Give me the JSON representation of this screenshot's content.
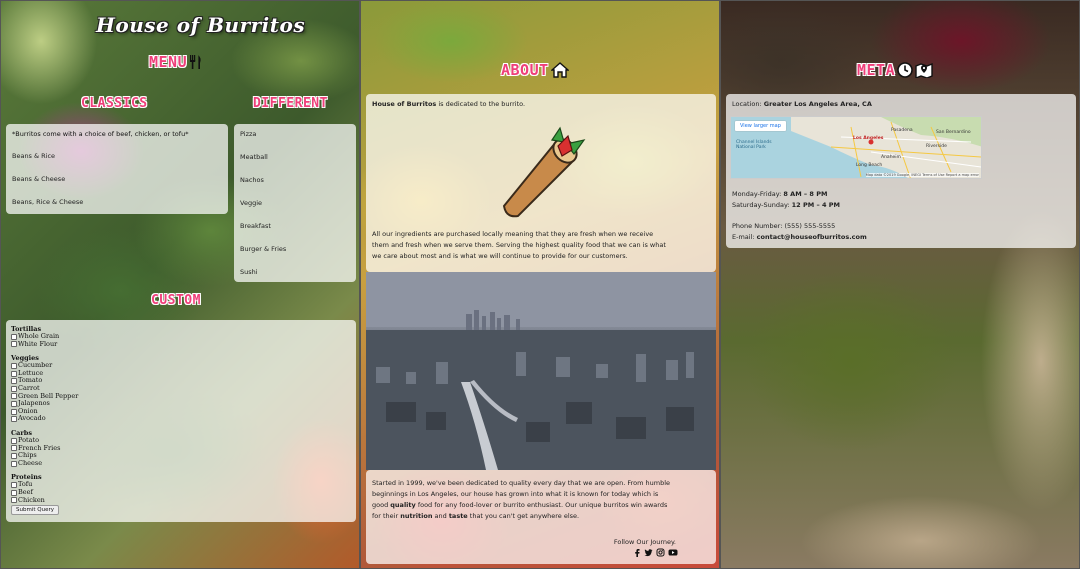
{
  "site": {
    "title": "House of Burritos"
  },
  "menu": {
    "heading": "MENU",
    "classics": {
      "heading": "CLASSICS",
      "note": "*Burritos come with a choice of beef, chicken, or tofu*",
      "items": [
        "Beans & Rice",
        "Beans & Cheese",
        "Beans, Rice & Cheese"
      ]
    },
    "different": {
      "heading": "DIFFERENT",
      "items": [
        "Pizza",
        "Meatball",
        "Nachos",
        "Veggie",
        "Breakfast",
        "Burger & Fries",
        "Sushi"
      ]
    },
    "custom": {
      "heading": "CUSTOM",
      "groups": [
        {
          "title": "Tortillas",
          "options": [
            "Whole Grain",
            "White Flour"
          ]
        },
        {
          "title": "Veggies",
          "options": [
            "Cucumber",
            "Lettuce",
            "Tomato",
            "Carrot",
            "Green Bell Pepper",
            "Jalapenos",
            "Onion",
            "Avocado"
          ]
        },
        {
          "title": "Carbs",
          "options": [
            "Potato",
            "French Fries",
            "Chips",
            "Cheese"
          ]
        },
        {
          "title": "Proteins",
          "options": [
            "Tofu",
            "Beef",
            "Chicken"
          ]
        }
      ],
      "submit_label": "Submit Query"
    }
  },
  "about": {
    "heading": "ABOUT",
    "intro_bold": "House of Burritos",
    "intro_rest": " is dedicated to the burrito.",
    "paragraph": "All our ingredients are purchased locally meaning that they are fresh when we receive them and fresh when we serve them. Serving the highest quality food that we can is what we care about most and is what we will continue to provide for our customers.",
    "story_part1": "Started in 1999, we've been dedicated to quality every day that we are open. From humble beginnings in Los Angeles, our house has grown into what it is known for today which is good ",
    "story_bold1": "quality",
    "story_part2": " food for any food-lover or burrito enthusiast. Our unique burritos win awards for their ",
    "story_bold2": "nutrition",
    "story_part3": " and ",
    "story_bold3": "taste",
    "story_part4": " that you can't get anywhere else.",
    "follow": "Follow Our Journey.",
    "socials": [
      "f",
      "t",
      "i",
      "y"
    ]
  },
  "meta": {
    "heading": "META",
    "location_label": "Location: ",
    "location_value": "Greater Los Angeles Area, CA",
    "map": {
      "button": "View larger map",
      "labels": [
        "Los Angeles",
        "Pasadena",
        "San Bernardino",
        "Anaheim",
        "Riverside",
        "Long Beach",
        "Channel Islands National Park"
      ],
      "attribution": "Map data ©2019 Google, INEGI   Terms of Use   Report a map error"
    },
    "weekday_label": "Monday-Friday: ",
    "weekday_hours": "8 AM – 8 PM",
    "weekend_label": "Saturday-Sunday: ",
    "weekend_hours": "12 PM – 4 PM",
    "phone_label": "Phone Number: ",
    "phone_value": "(555) 555-5555",
    "email_label": "E-mail: ",
    "email_value": "contact@houseofburritos.com"
  }
}
